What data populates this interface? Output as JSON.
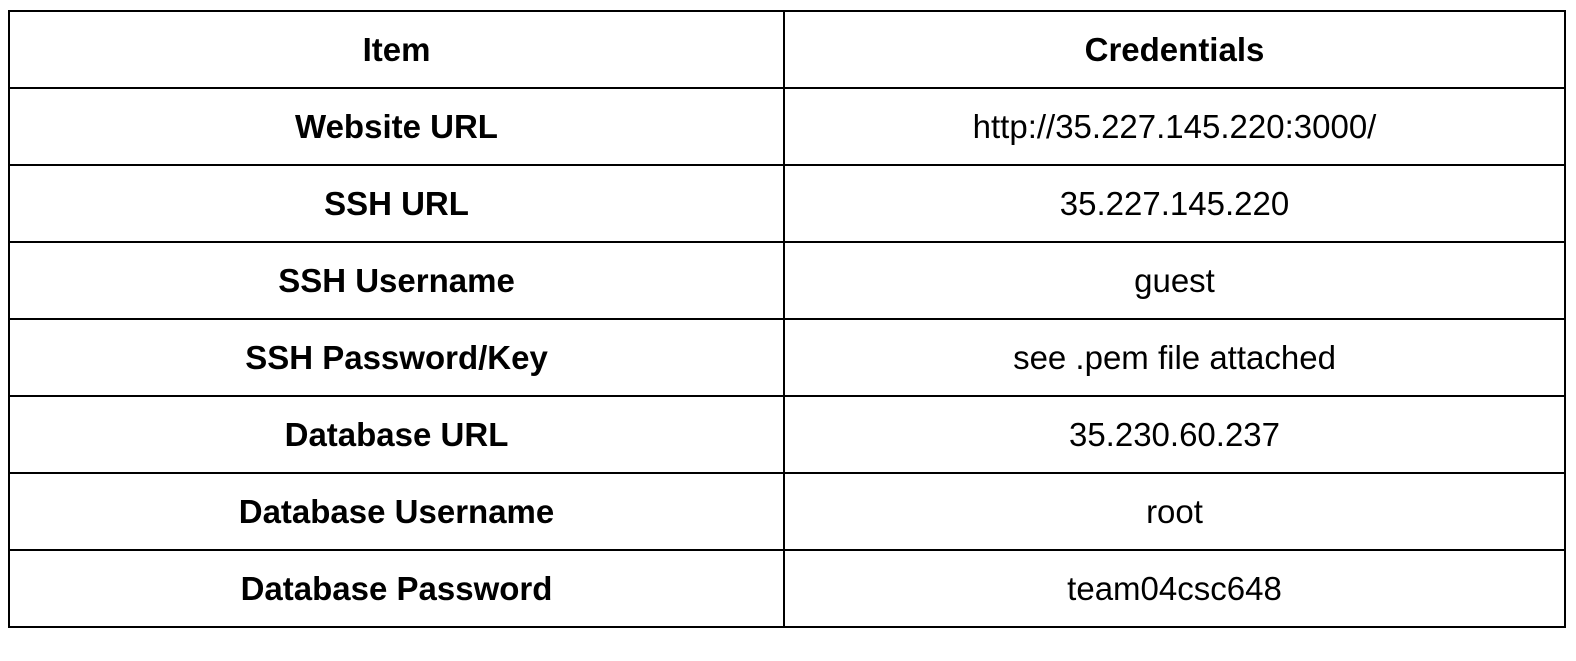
{
  "table": {
    "headers": {
      "item": "Item",
      "credentials": "Credentials"
    },
    "rows": [
      {
        "item": "Website URL",
        "value": "http://35.227.145.220:3000/"
      },
      {
        "item": "SSH URL",
        "value": "35.227.145.220"
      },
      {
        "item": "SSH Username",
        "value": "guest"
      },
      {
        "item": "SSH Password/Key",
        "value": "see .pem file attached"
      },
      {
        "item": "Database URL",
        "value": "35.230.60.237"
      },
      {
        "item": "Database Username",
        "value": "root"
      },
      {
        "item": "Database Password",
        "value": "team04csc648"
      }
    ]
  },
  "colors": {
    "text": "#000000",
    "border": "#000000",
    "background": "#ffffff"
  }
}
